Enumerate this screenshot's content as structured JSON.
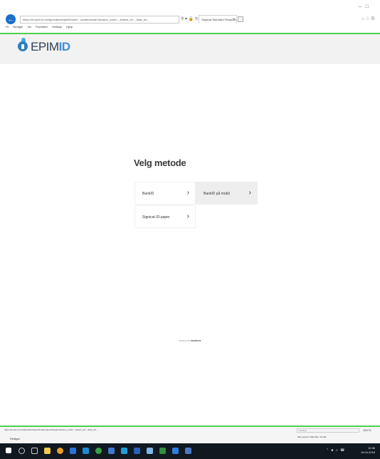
{
  "browser": {
    "url": "https://id.epim-id.no/idp/realms/epim/broker/.../authenticate?session_code=...&client_id=...&tab_id=...",
    "tab_title": "Signicat Standard Template",
    "menu": [
      "Fil",
      "Rediger",
      "Vis",
      "Favoritter",
      "Verktøy",
      "Hjelp"
    ],
    "status_url": "https://id.epim-id.no/idp/realms/epim/broker/signicat/login?session_code=...&client_id=...&tab_id=...",
    "status_label": "Rediger",
    "zoom": "100 %",
    "notification_placeholder": "Varsling",
    "notification_links": "Ikke opprett, Skjul alle, Vis alle"
  },
  "header": {
    "logo_prefix": "EPIM",
    "logo_suffix": "ID"
  },
  "main": {
    "title": "Velg metode",
    "methods": [
      {
        "label": "BankID",
        "icon": "chevron-right-icon"
      },
      {
        "label": "BankID på mobil",
        "icon": "chevron-right-icon"
      },
      {
        "label": "Signicat ID-paper",
        "icon": "chevron-right-icon"
      }
    ],
    "powered_by_prefix": "Powered by",
    "powered_by_brand": "SIGNICAT"
  },
  "taskbar": {
    "time": "10:36",
    "date": "16.04.2018"
  },
  "colors": {
    "accent_green": "#4cd24c",
    "logo_blue": "#2a7fc1",
    "taskbar": "#111820"
  }
}
